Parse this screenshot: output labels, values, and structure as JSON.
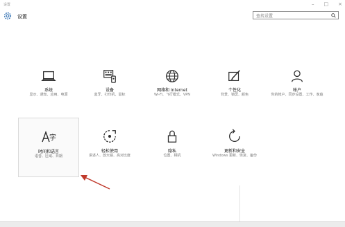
{
  "window": {
    "title": "设置"
  },
  "header": {
    "title": "设置",
    "search_placeholder": "查找设置"
  },
  "tiles": [
    {
      "label": "系统",
      "desc": "显示、通知、应用、电源"
    },
    {
      "label": "设备",
      "desc": "蓝牙、打印机、鼠标"
    },
    {
      "label": "网络和 Internet",
      "desc": "Wi-Fi、飞行模式、VPN"
    },
    {
      "label": "个性化",
      "desc": "背景、锁屏、颜色"
    },
    {
      "label": "帐户",
      "desc": "你的帐户、同步设置、工作、家庭"
    },
    {
      "label": "时间和语言",
      "desc": "语音、区域、日期"
    },
    {
      "label": "轻松使用",
      "desc": "讲述人、放大镜、高对比度"
    },
    {
      "label": "隐私",
      "desc": "位置、相机"
    },
    {
      "label": "更新和安全",
      "desc": "Windows 更新、恢复、备份"
    }
  ],
  "icons": {
    "gear": "gear-icon",
    "search": "search-icon",
    "system": "laptop-icon",
    "devices": "keyboard-device-icon",
    "network": "globe-icon",
    "personalization": "paint-brush-icon",
    "accounts": "person-icon",
    "time_language": "language-clock-icon",
    "ease_of_access": "ease-of-access-icon",
    "privacy": "lock-icon",
    "update_security": "refresh-icon"
  },
  "colors": {
    "icon": "#2b2b2b",
    "description_text": "#7a7a7a",
    "annotation_arrow": "#c0392b"
  }
}
